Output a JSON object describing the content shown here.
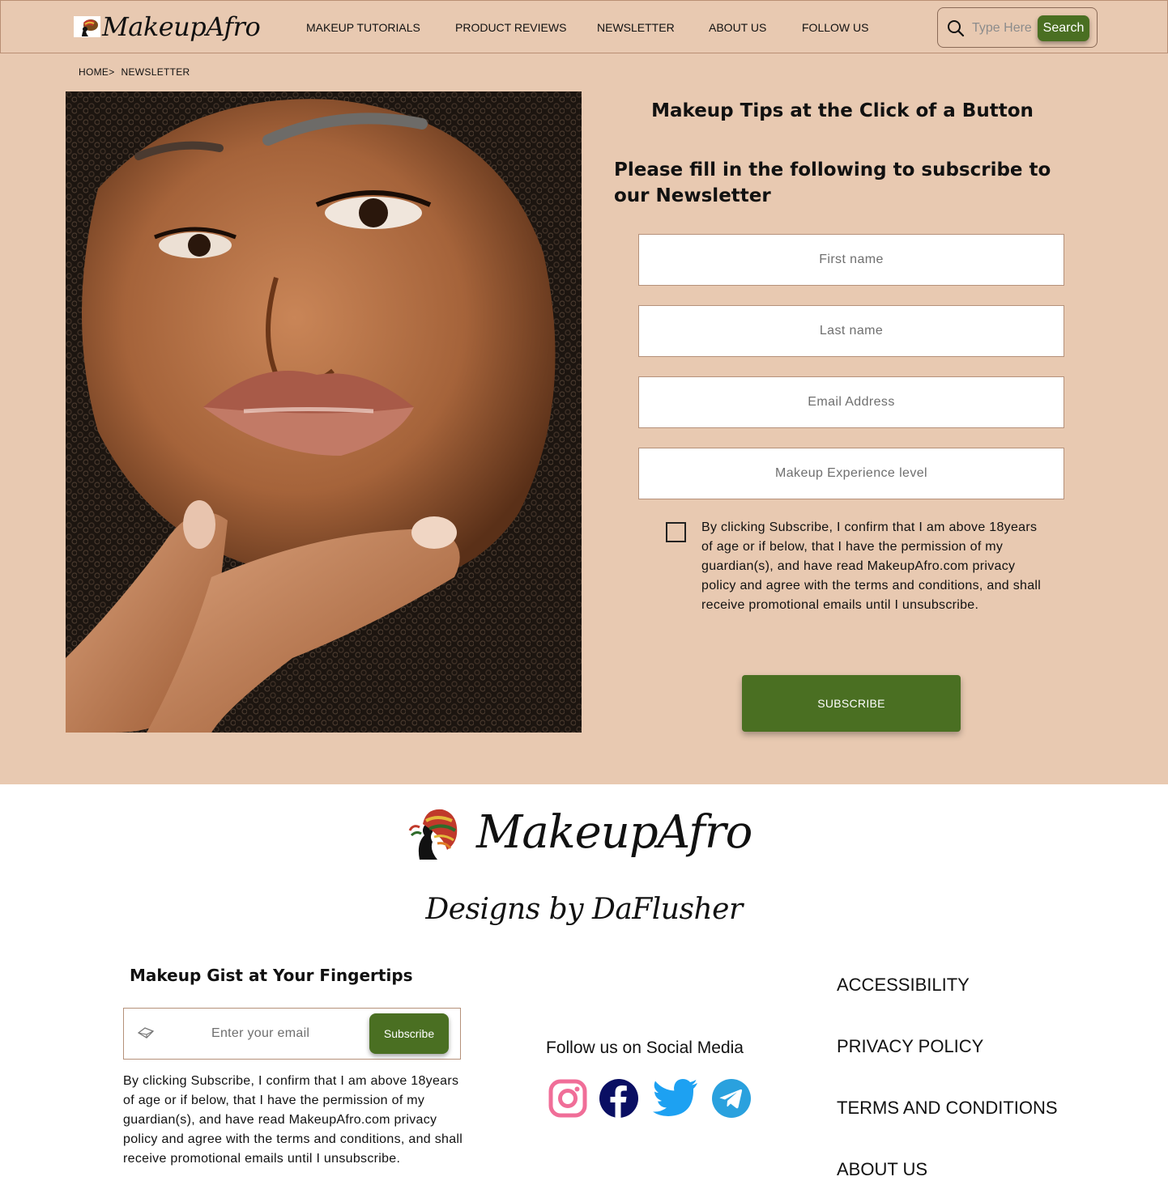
{
  "header": {
    "brand": "MakeupAfro",
    "nav": [
      {
        "label": "MAKEUP TUTORIALS"
      },
      {
        "label": "PRODUCT REVIEWS"
      },
      {
        "label": "NEWSLETTER"
      },
      {
        "label": "ABOUT US"
      },
      {
        "label": "FOLLOW US"
      }
    ],
    "search": {
      "placeholder": "Type Here",
      "button_label": "Search"
    }
  },
  "breadcrumb": [
    "HOME>",
    "NEWSLETTER"
  ],
  "main": {
    "hero_image": "woman-portrait",
    "title": "Makeup Tips at the Click of a Button",
    "subtitle": "Please fill in the following to subscribe to our Newsletter",
    "fields": {
      "first_name": "First name",
      "last_name": "Last name",
      "email": "Email Address",
      "experience": "Makeup Experience level"
    },
    "consent_checked": false,
    "consent_text": "By clicking Subscribe, I confirm that I am above 18years of age or if below, that I have the permission of my guardian(s), and have read MakeupAfro.com privacy policy and agree with the terms and conditions, and shall receive promotional emails until I unsubscribe.",
    "subscribe_label": "SUBSCRIBE"
  },
  "footer": {
    "brand": "MakeupAfro",
    "credits": "Designs by DaFlusher",
    "gist_title": "Makeup Gist at Your Fingertips",
    "email_placeholder": "Enter your email",
    "email_button": "Subscribe",
    "consent_text": "By clicking Subscribe, I confirm that I am above 18years of age or if below, that I have the permission of my guardian(s), and have read MakeupAfro.com privacy policy and agree with the terms and conditions, and shall receive promotional emails until I unsubscribe.",
    "social_title": "Follow us on Social Media",
    "social_icons": [
      "instagram-icon",
      "facebook-icon",
      "twitter-icon",
      "telegram-icon"
    ],
    "links": [
      "ACCESSIBILITY",
      "PRIVACY POLICY",
      "TERMS AND CONDITIONS",
      "ABOUT US"
    ]
  },
  "colors": {
    "background_peach": "#e8c9b1",
    "button_green": "#4a6f22",
    "border": "#b5917a"
  }
}
